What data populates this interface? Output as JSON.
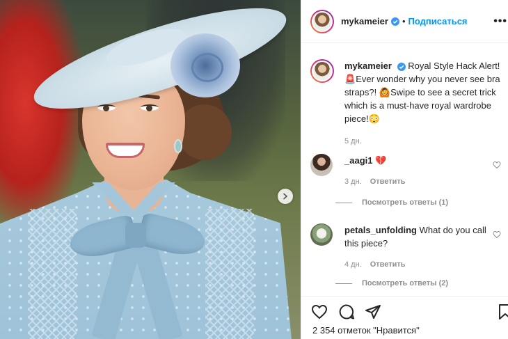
{
  "post": {
    "username": "mykameier",
    "follow_label": "Подписаться",
    "separator": "•",
    "more_label": "•••"
  },
  "caption": {
    "username": "mykameier",
    "text_1": "Royal Style Hack Alert!",
    "emoji_1": "🚨",
    "text_2": "Ever wonder why you never see bra straps?!",
    "emoji_2": "🙆",
    "text_3": "Swipe to see a secret trick which is a must-have royal wardrobe piece!",
    "emoji_3": "😳",
    "time": "5 дн."
  },
  "comments": [
    {
      "username": "_aagi1",
      "text": "💔",
      "time": "3 дн.",
      "reply_label": "Ответить",
      "view_replies": "Посмотреть ответы (1)"
    },
    {
      "username": "petals_unfolding",
      "text": "What do you call this piece?",
      "time": "4 дн.",
      "reply_label": "Ответить",
      "view_replies": "Посмотреть ответы (2)"
    }
  ],
  "likes": {
    "text": "2 354 отметок \"Нравится\""
  },
  "colors": {
    "link_blue": "#0095f6",
    "verified_blue": "#3897f0",
    "muted_gray": "#8e8e8e",
    "text": "#262626",
    "heart_red": "#ed4956"
  },
  "icons": [
    "verified-badge-icon",
    "heart-icon",
    "comment-icon",
    "share-icon",
    "bookmark-icon",
    "chevron-right-icon"
  ]
}
